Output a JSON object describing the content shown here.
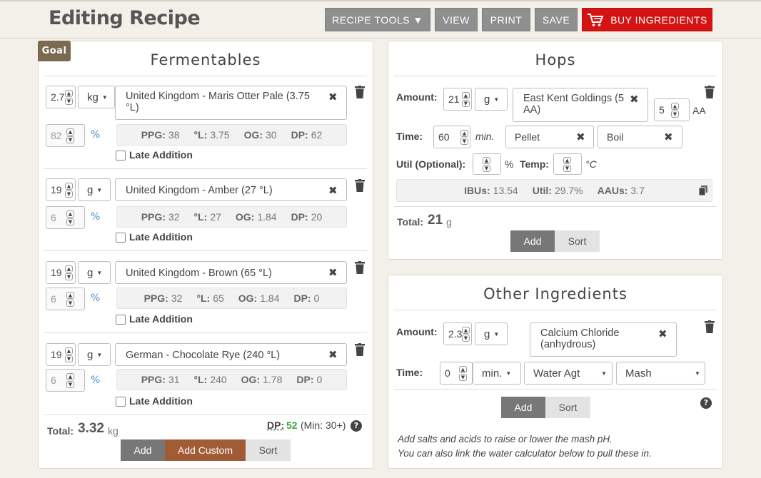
{
  "header": {
    "title": "Editing Recipe",
    "buttons": {
      "recipe_tools": "RECIPE TOOLS ▼",
      "view": "VIEW",
      "print": "PRINT",
      "save": "SAVE",
      "buy": "BUY INGREDIENTS"
    }
  },
  "fermentables": {
    "goal_tab": "Goal",
    "title": "Fermentables",
    "late_label": "Late Addition",
    "items": [
      {
        "amount": "2.7",
        "unit": "kg",
        "name": "United Kingdom - Maris Otter Pale (3.75 °L)",
        "pct": "82",
        "ppg": "38",
        "lov": "3.75",
        "og": "30",
        "dp": "62"
      },
      {
        "amount": "19",
        "unit": "g",
        "name": "United Kingdom - Amber (27 °L)",
        "pct": "6",
        "ppg": "32",
        "lov": "27",
        "og": "1.84",
        "dp": "20"
      },
      {
        "amount": "19",
        "unit": "g",
        "name": "United Kingdom - Brown (65 °L)",
        "pct": "6",
        "ppg": "32",
        "lov": "65",
        "og": "1.84",
        "dp": "0"
      },
      {
        "amount": "19",
        "unit": "g",
        "name": "German - Chocolate Rye (240 °L)",
        "pct": "6",
        "ppg": "31",
        "lov": "240",
        "og": "1.78",
        "dp": "0"
      }
    ],
    "stat_labels": {
      "ppg": "PPG:",
      "lov": "°L:",
      "og": "OG:",
      "dp": "DP:"
    },
    "pct_symbol": "%",
    "total_label": "Total:",
    "total_value": "3.32",
    "total_unit": "kg",
    "dp_label": "DP:",
    "dp_value": "52",
    "dp_min": "(Min: 30+)",
    "buttons": {
      "add": "Add",
      "add_custom": "Add Custom",
      "sort": "Sort"
    }
  },
  "hops": {
    "title": "Hops",
    "amount_label": "Amount:",
    "amount": "21",
    "unit": "g",
    "name": "East Kent Goldings (5 AA)",
    "aa_value": "5",
    "aa_label": "AA",
    "time_label": "Time:",
    "time_value": "60",
    "time_unit": "min.",
    "form": "Pellet",
    "use": "Boil",
    "util_label": "Util (Optional):",
    "util_unit": "%",
    "temp_label": "Temp:",
    "temp_unit": "°C",
    "ibus_label": "IBUs:",
    "ibus": "13.54",
    "util_stat_label": "Util:",
    "util_stat": "29.7%",
    "aaus_label": "AAUs:",
    "aaus": "3.7",
    "total_label": "Total:",
    "total_value": "21",
    "total_unit": "g",
    "buttons": {
      "add": "Add",
      "sort": "Sort"
    }
  },
  "other": {
    "title": "Other Ingredients",
    "amount_label": "Amount:",
    "amount": "2.3",
    "unit": "g",
    "name": "Calcium Chloride (anhydrous)",
    "time_label": "Time:",
    "time_value": "0",
    "time_unit": "min.",
    "type": "Water Agt",
    "use": "Mash",
    "buttons": {
      "add": "Add",
      "sort": "Sort"
    },
    "note_line1": "Add salts and acids to raise or lower the mash pH.",
    "note_line2": "You can also link the water calculator below to pull these in."
  },
  "colors": {
    "accent_red": "#d51313",
    "accent_brown": "#a15c36",
    "dp_green": "#3aa53a",
    "pct_blue": "#4a90d6"
  }
}
